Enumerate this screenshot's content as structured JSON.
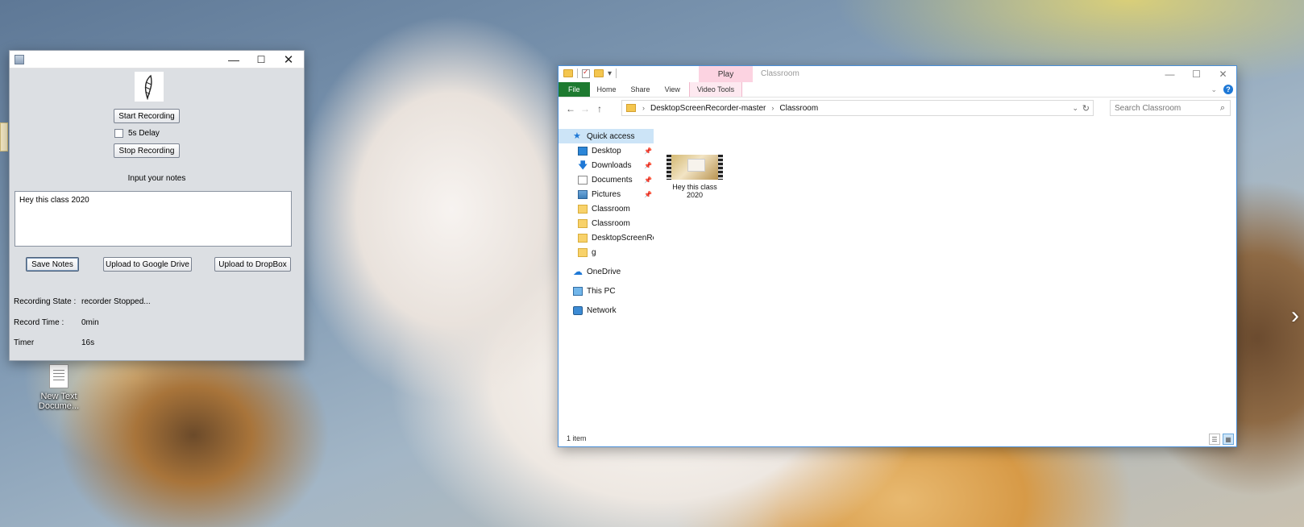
{
  "desktop": {
    "icon_line1": "New Text",
    "icon_line2": "Docume...",
    "next_arrow": "›"
  },
  "recorder": {
    "buttons": {
      "start": "Start Recording",
      "stop": "Stop Recording",
      "save": "Save Notes",
      "gdrive": "Upload to Google Drive",
      "dropbox": "Upload to DropBox"
    },
    "delay_label": "5s Delay",
    "notes_label": "Input your notes",
    "notes_text": "Hey this class 2020",
    "info": {
      "state_label": "Recording State :",
      "state_value": "recorder Stopped...",
      "time_label": "Record Time :",
      "time_value": "0min",
      "timer_label": "Timer",
      "timer_value": "16s"
    }
  },
  "explorer": {
    "title": "Classroom",
    "context_tab": "Play",
    "ribbon_tabs": [
      "File",
      "Home",
      "Share",
      "View",
      "Video Tools"
    ],
    "breadcrumb": [
      "DesktopScreenRecorder-master",
      "Classroom"
    ],
    "search_placeholder": "Search Classroom",
    "nav": {
      "quick_access": "Quick access",
      "items": [
        "Desktop",
        "Downloads",
        "Documents",
        "Pictures",
        "Classroom",
        "Classroom",
        "DesktopScreenReco",
        "g"
      ],
      "onedrive": "OneDrive",
      "this_pc": "This PC",
      "network": "Network"
    },
    "file": {
      "name_line1": "Hey this class",
      "name_line2": "2020"
    },
    "status": "1 item"
  }
}
